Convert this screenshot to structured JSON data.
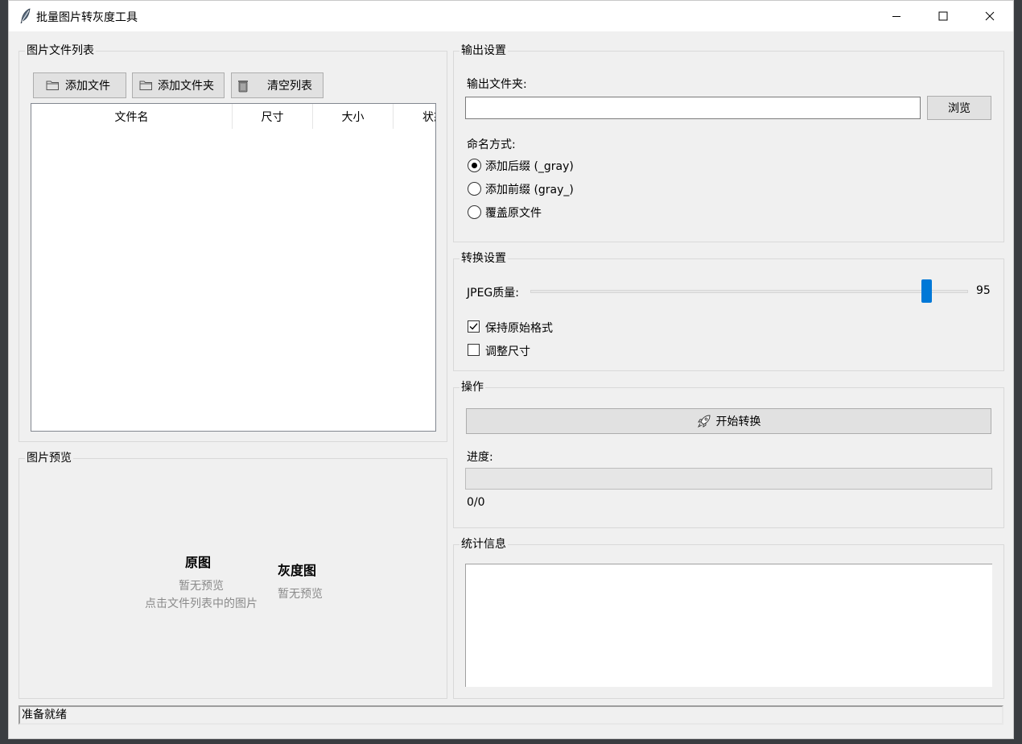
{
  "window": {
    "title": "批量图片转灰度工具",
    "icons": {
      "app": "feather-icon",
      "minimize": "minimize-icon",
      "maximize": "maximize-icon",
      "close": "close-icon"
    }
  },
  "file_list": {
    "group_label": "图片文件列表",
    "buttons": {
      "add_file": "添加文件",
      "add_folder": "添加文件夹",
      "clear_list": "清空列表"
    },
    "icons": {
      "add_file": "folder-icon",
      "add_folder": "folder-icon",
      "clear_list": "trash-icon"
    },
    "columns": [
      "文件名",
      "尺寸",
      "大小",
      "状态"
    ],
    "rows": []
  },
  "preview": {
    "group_label": "图片预览",
    "original": {
      "title": "原图",
      "placeholder": "暂无预览",
      "hint": "点击文件列表中的图片"
    },
    "grayscale": {
      "title": "灰度图",
      "placeholder": "暂无预览"
    }
  },
  "output": {
    "group_label": "输出设置",
    "folder_label": "输出文件夹:",
    "folder_value": "",
    "browse": "浏览",
    "naming_label": "命名方式:",
    "naming_options": [
      {
        "label": "添加后缀 (_gray)",
        "selected": true
      },
      {
        "label": "添加前缀 (gray_)",
        "selected": false
      },
      {
        "label": "覆盖原文件",
        "selected": false
      }
    ]
  },
  "conversion": {
    "group_label": "转换设置",
    "jpeg_label": "JPEG质量:",
    "jpeg_value": 95,
    "jpeg_min": 1,
    "jpeg_max": 100,
    "keep_format": {
      "label": "保持原始格式",
      "checked": true
    },
    "resize": {
      "label": "调整尺寸",
      "checked": false
    },
    "accent_color": "#0078d7"
  },
  "operation": {
    "group_label": "操作",
    "start_button": "开始转换",
    "start_icon": "rocket-icon",
    "progress_label": "进度:",
    "progress_value": 0,
    "progress_text": "0/0"
  },
  "stats": {
    "group_label": "统计信息",
    "content": ""
  },
  "status_bar": {
    "text": "准备就绪"
  }
}
